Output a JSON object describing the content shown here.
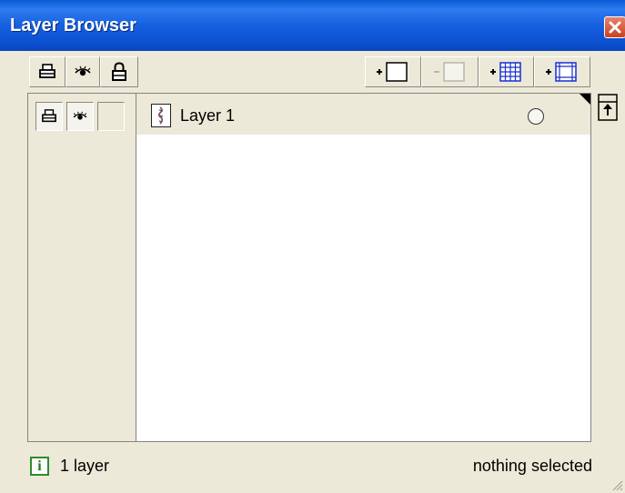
{
  "window": {
    "title": "Layer Browser",
    "close_icon": "close-icon"
  },
  "toolbar": {
    "left_buttons": [
      {
        "name": "print-toggle-button",
        "icon": "printer-icon"
      },
      {
        "name": "visibility-toggle-button",
        "icon": "eye-icon"
      },
      {
        "name": "lock-toggle-button",
        "icon": "lock-icon"
      }
    ],
    "right_buttons": [
      {
        "name": "add-layer-button",
        "icon": "add-layer-icon",
        "enabled": true
      },
      {
        "name": "remove-layer-button",
        "icon": "remove-layer-icon",
        "enabled": false
      },
      {
        "name": "add-grid-layer-button",
        "icon": "add-grid-layer-icon",
        "enabled": true
      },
      {
        "name": "add-guide-layer-button",
        "icon": "add-guide-layer-icon",
        "enabled": true
      }
    ]
  },
  "layers": [
    {
      "name": "Layer 1",
      "printable": true,
      "visible": true,
      "locked": false,
      "selected": false
    }
  ],
  "status": {
    "count": "1 layer",
    "selection": "nothing selected",
    "info_icon": "i"
  },
  "colors": {
    "title_bar": "#0a5bd6",
    "panel_bg": "#ece9d8",
    "info_green": "#2e8b2e"
  }
}
